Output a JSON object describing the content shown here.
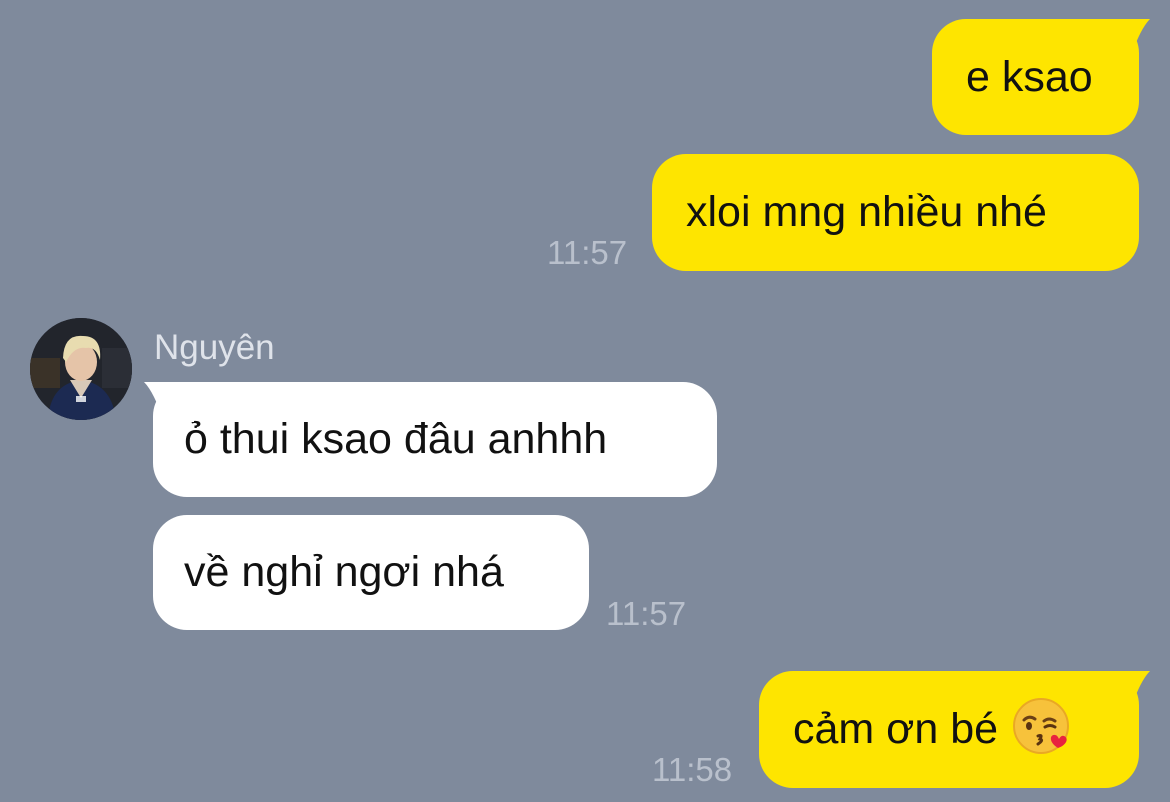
{
  "colors": {
    "background": "#7f8a9c",
    "outgoing_bubble": "#fee500",
    "incoming_bubble": "#ffffff",
    "timestamp": "#b9c0cc"
  },
  "messages": {
    "out_1": {
      "text": "e ksao"
    },
    "out_2": {
      "text": "xloi mng nhiều nhé",
      "time": "11:57"
    },
    "in_sender": "Nguyên",
    "in_1": {
      "text": "ỏ thui ksao đâu anhhh"
    },
    "in_2": {
      "text": "về nghỉ ngơi nhá",
      "time": "11:57"
    },
    "out_3": {
      "text": "cảm ơn bé",
      "emoji": "kissing-face-with-heart-emoji",
      "time": "11:58"
    }
  }
}
